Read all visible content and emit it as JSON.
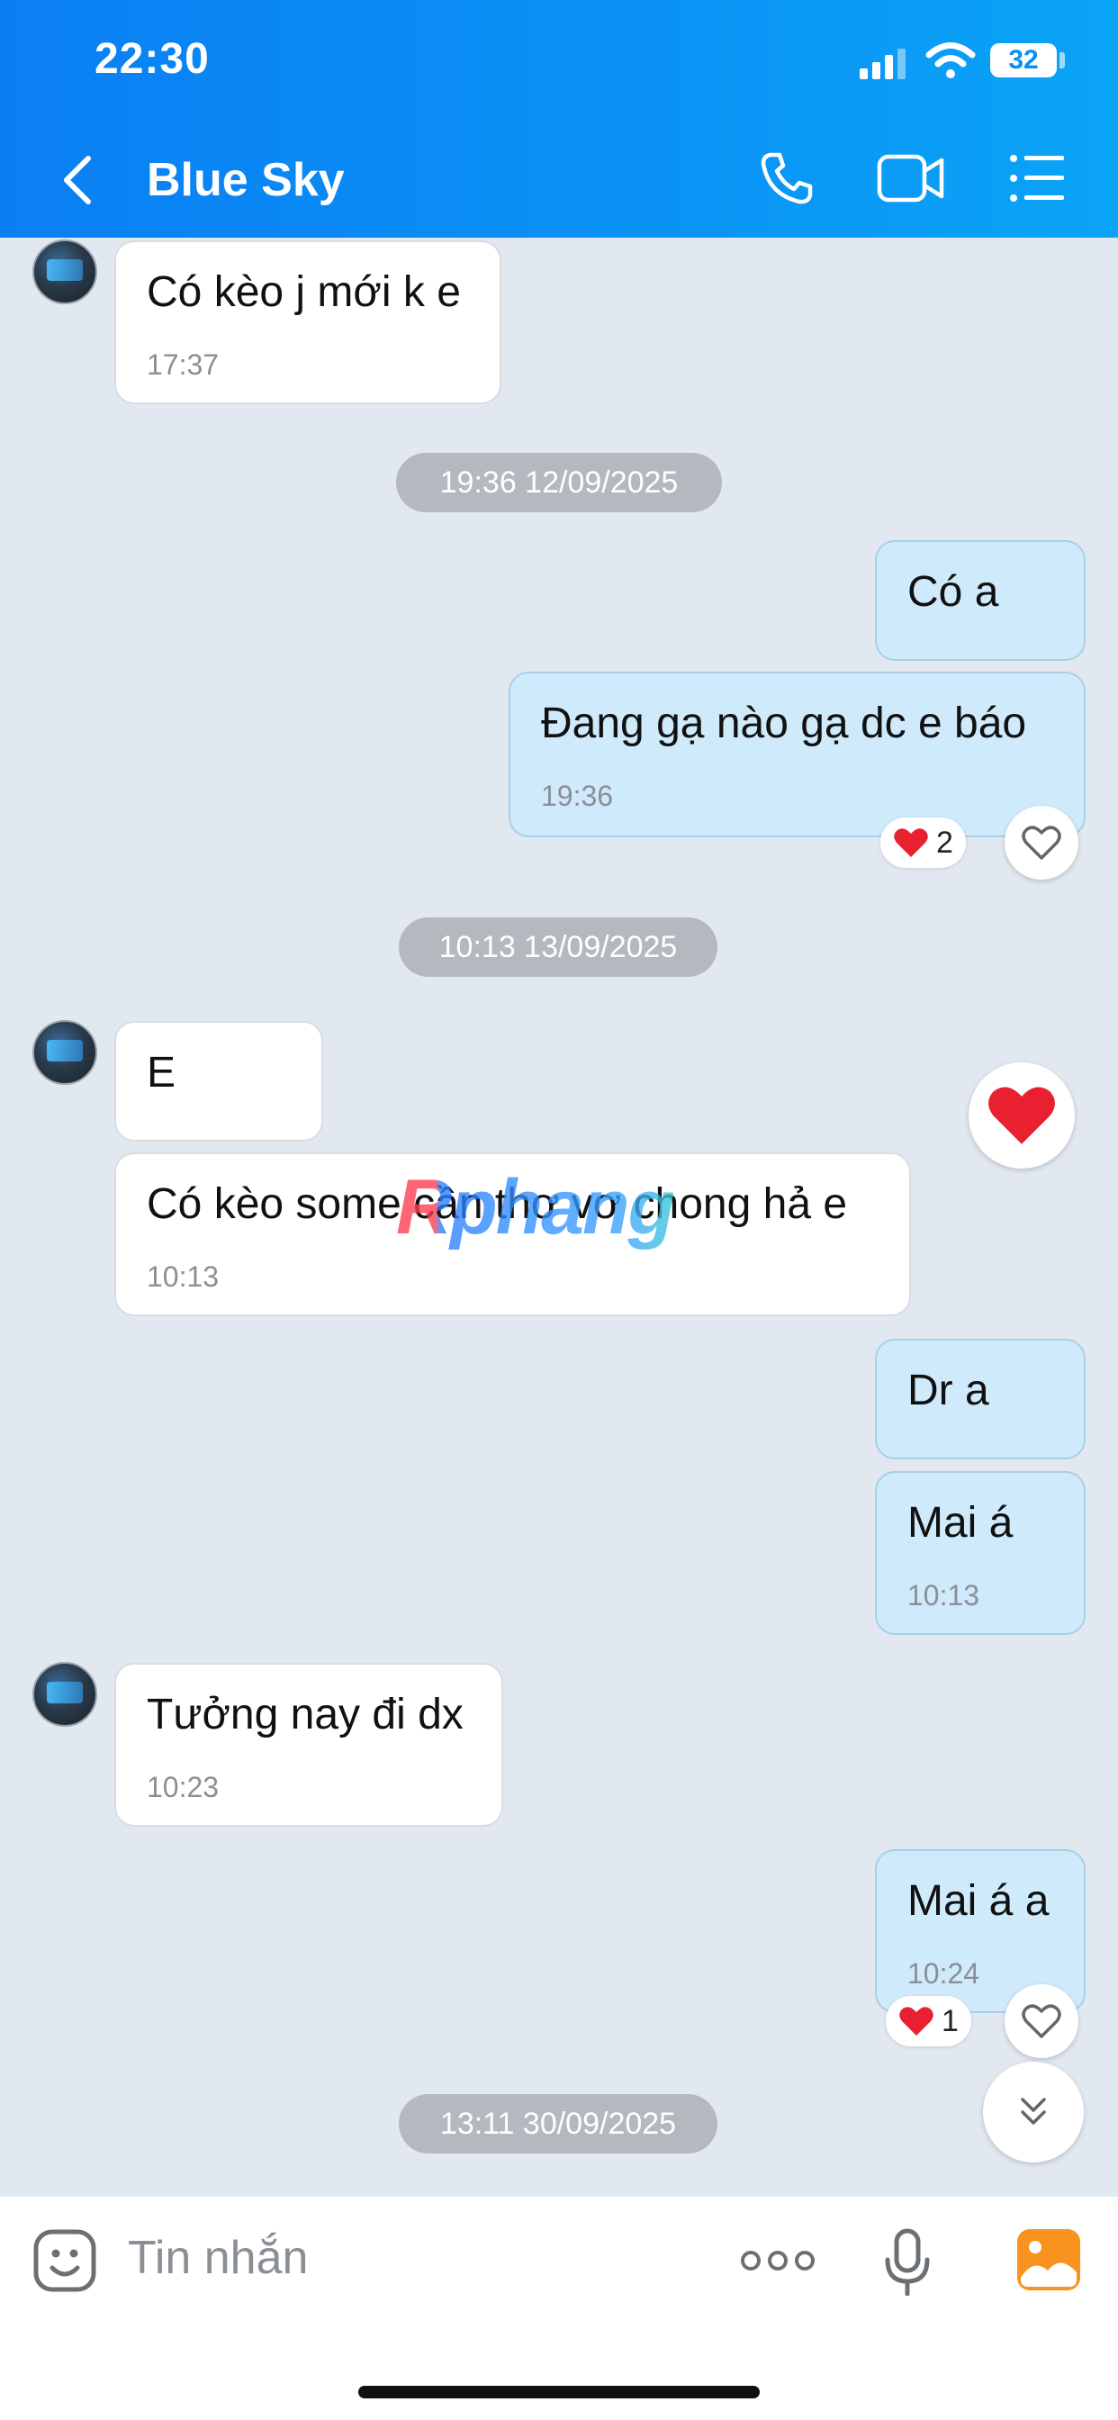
{
  "status_bar": {
    "time": "22:30",
    "battery": "32"
  },
  "header": {
    "title": "Blue Sky"
  },
  "messages": [
    {
      "text": "Có kèo j mới k e",
      "time": "17:37"
    },
    {
      "text": "Có a"
    },
    {
      "text": "Đang gạ nào gạ dc e báo",
      "time": "19:36",
      "reaction_count": "2"
    },
    {
      "text": "E"
    },
    {
      "text": "Có kèo some cần thơ vơ chong hả e",
      "time": "10:13"
    },
    {
      "text": "Dr a"
    },
    {
      "text": "Mai á",
      "time": "10:13"
    },
    {
      "text": "Tưởng nay đi dx",
      "time": "10:23"
    },
    {
      "text": "Mai á a",
      "time": "10:24",
      "reaction_count": "1"
    }
  ],
  "date_separators": [
    "19:36 12/09/2025",
    "10:13 13/09/2025",
    "13:11 30/09/2025"
  ],
  "watermark": "Rphang",
  "composer": {
    "placeholder": "Tin nhắn"
  },
  "colors": {
    "header": "#0a8ff5",
    "incoming": "#ffffff",
    "outgoing": "#cfeafb",
    "heart": "#e8202f",
    "photo": "#f7931e"
  },
  "icons": [
    "back-icon",
    "phone-icon",
    "video-call-icon",
    "menu-icon",
    "heart-icon",
    "scroll-down-icon",
    "emoji-icon",
    "more-icon",
    "microphone-icon",
    "photo-icon"
  ]
}
